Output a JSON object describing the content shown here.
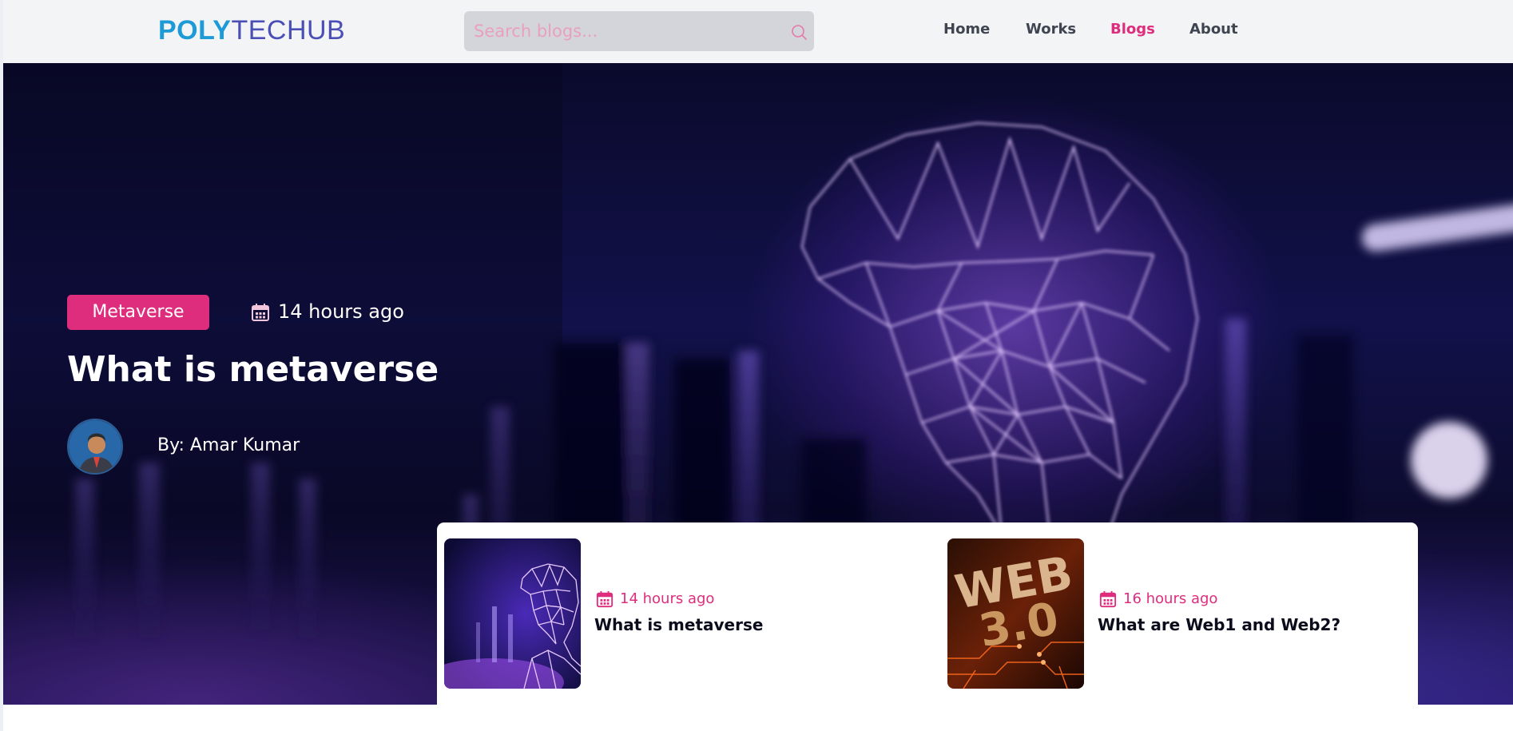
{
  "brand": {
    "logo_part1": "POLY",
    "logo_part2": "TECHUB"
  },
  "search": {
    "placeholder": "Search blogs...",
    "icon": "search-icon"
  },
  "nav": {
    "items": [
      {
        "label": "Home",
        "active": false
      },
      {
        "label": "Works",
        "active": false
      },
      {
        "label": "Blogs",
        "active": true
      },
      {
        "label": "About",
        "active": false
      }
    ]
  },
  "hero": {
    "category": "Metaverse",
    "date": "14 hours ago",
    "date_icon": "calendar-icon",
    "title": "What is metaverse",
    "author": "By: Amar Kumar",
    "avatar_icon": "avatar"
  },
  "recent_posts": [
    {
      "date": "14 hours ago",
      "title": "What is metaverse",
      "thumb": "metaverse-vr-wireframe-thumbnail"
    },
    {
      "date": "16 hours ago",
      "title": "What are Web1 and Web2?",
      "thumb": "web-3-0-circuit-thumbnail"
    }
  ],
  "colors": {
    "accent": "#df2d7e",
    "logo_blue": "#1e9ad6",
    "logo_indigo": "#4b4fb5",
    "header_bg": "#f3f4f6",
    "search_bg": "#d4d5db"
  }
}
